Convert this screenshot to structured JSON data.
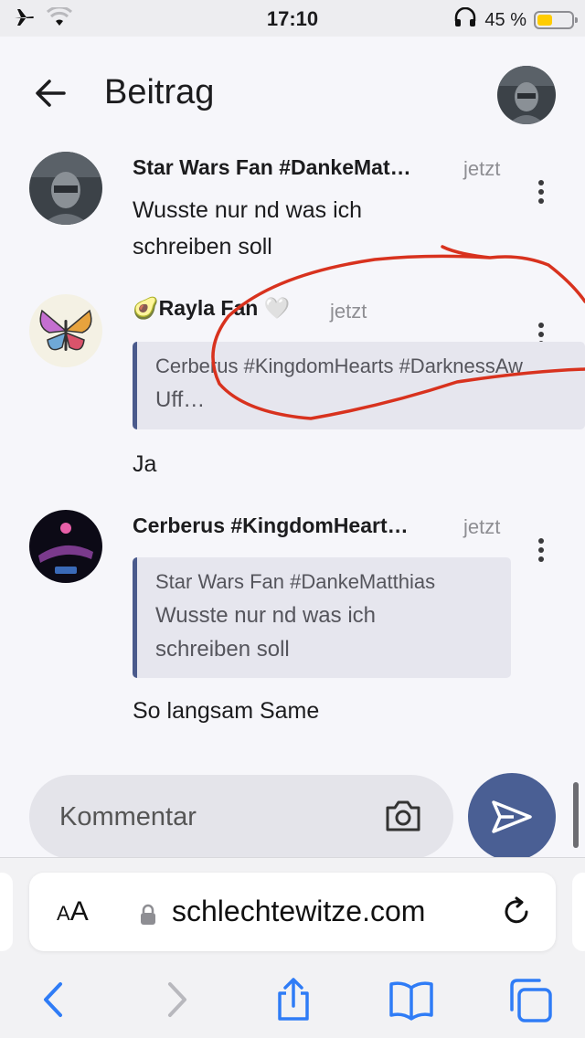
{
  "status_bar": {
    "time": "17:10",
    "battery_percent": "45 %",
    "battery_level": 0.45,
    "battery_color": "#ffcc00",
    "icons": [
      "airplane-icon",
      "wifi-icon",
      "headphones-icon",
      "battery-icon"
    ]
  },
  "header": {
    "title": "Beitrag",
    "back_icon": "arrow-left-icon"
  },
  "comments": [
    {
      "author": "Star Wars Fan #DankeMat…",
      "time": "jetzt",
      "text_lines": [
        "Wusste nur nd was ich",
        "schreiben soll"
      ]
    },
    {
      "author_prefix_emoji": "🥑",
      "author": "Rayla Fan",
      "author_suffix_emoji": "🤍",
      "time": "jetzt",
      "quote": {
        "author": "Cerberus #KingdomHearts #DarknessAw",
        "text": "Uff…"
      },
      "text": "Ja"
    },
    {
      "author": "Cerberus #KingdomHeart…",
      "time": "jetzt",
      "quote": {
        "author": "Star Wars Fan #DankeMatthias",
        "text_lines": [
          "Wusste nur nd was ich",
          "schreiben soll"
        ]
      },
      "text": "So langsam Same"
    }
  ],
  "composer": {
    "placeholder": "Kommentar",
    "camera_icon": "camera-icon",
    "send_icon": "send-icon",
    "accent_color": "#4a5f94"
  },
  "browser": {
    "aa_label_small": "A",
    "aa_label_large": "A",
    "url": "schlechtewitze.com",
    "toolbar_icons": [
      "back-icon",
      "forward-icon",
      "share-icon",
      "bookmarks-icon",
      "tabs-icon"
    ],
    "accent_color": "#2f7cf6"
  },
  "annotation_color": "#d8321e"
}
